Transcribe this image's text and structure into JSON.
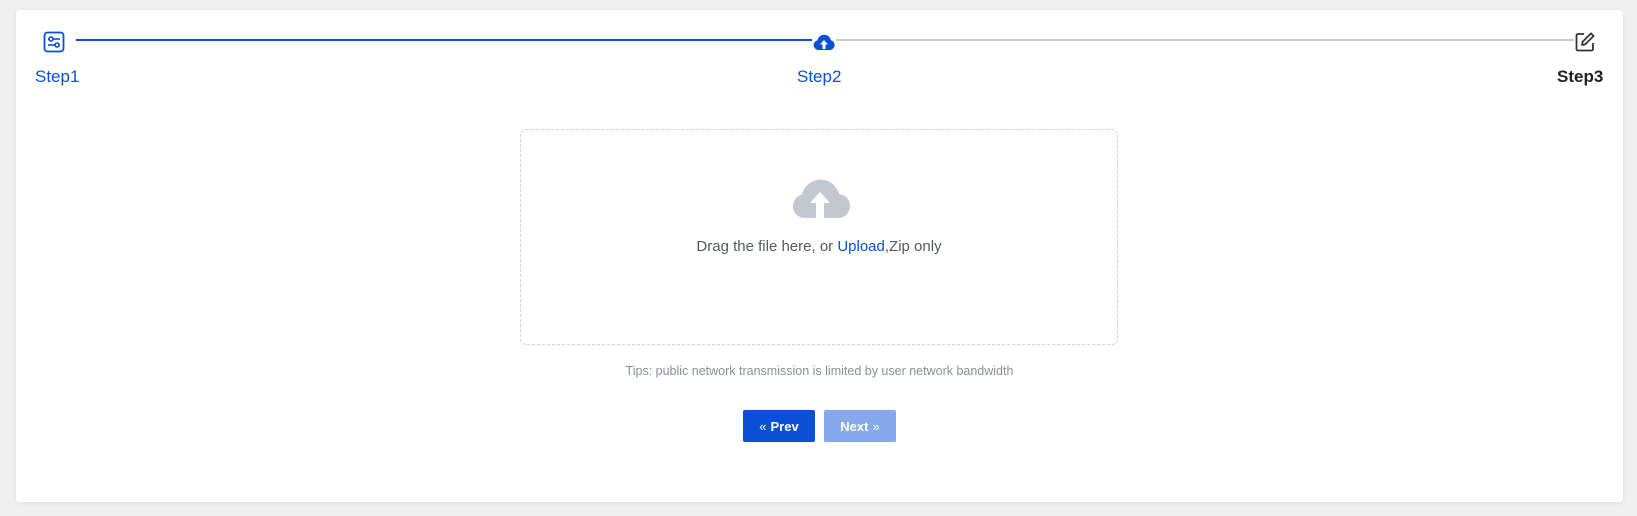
{
  "steps": {
    "step1": {
      "label": "Step1",
      "state": "completed",
      "icon": "sliders-icon"
    },
    "step2": {
      "label": "Step2",
      "state": "active",
      "icon": "cloud-upload-icon"
    },
    "step3": {
      "label": "Step3",
      "state": "pending",
      "icon": "edit-icon"
    }
  },
  "dropzone": {
    "text_before": "Drag the file here, or ",
    "upload_link": "Upload",
    "text_after": ",Zip only",
    "icon": "cloud-upload-icon"
  },
  "tips": "Tips: public network transmission is limited by user network bandwidth",
  "buttons": {
    "prev_label": "Prev",
    "next_label": "Next",
    "next_enabled": false
  },
  "colors": {
    "accent": "#0a4fd6",
    "disabled_button": "#86a8ec",
    "pending_line": "#c8ccd2",
    "icon_gray": "#c3c8d0",
    "page_background": "#f0f0f0"
  }
}
